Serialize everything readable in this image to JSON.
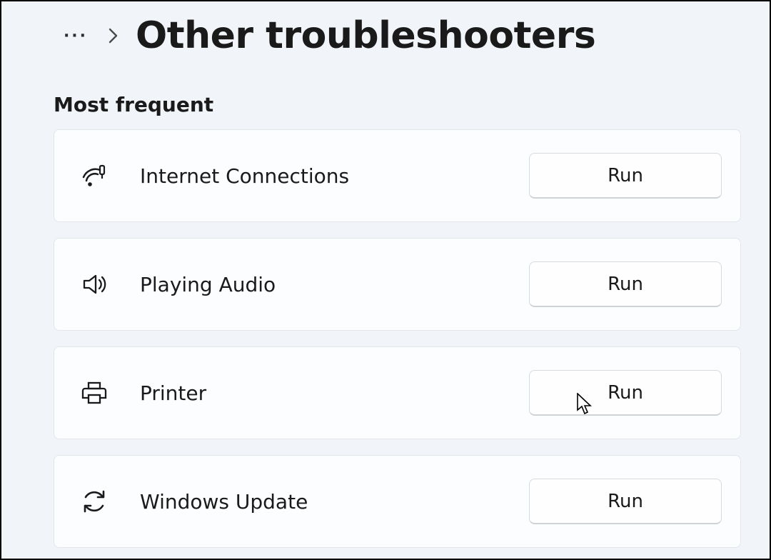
{
  "header": {
    "title": "Other troubleshooters"
  },
  "section": {
    "heading": "Most frequent"
  },
  "items": [
    {
      "icon": "wifi-icon",
      "label": "Internet Connections",
      "action": "Run"
    },
    {
      "icon": "speaker-icon",
      "label": "Playing Audio",
      "action": "Run"
    },
    {
      "icon": "printer-icon",
      "label": "Printer",
      "action": "Run"
    },
    {
      "icon": "refresh-icon",
      "label": "Windows Update",
      "action": "Run"
    }
  ]
}
